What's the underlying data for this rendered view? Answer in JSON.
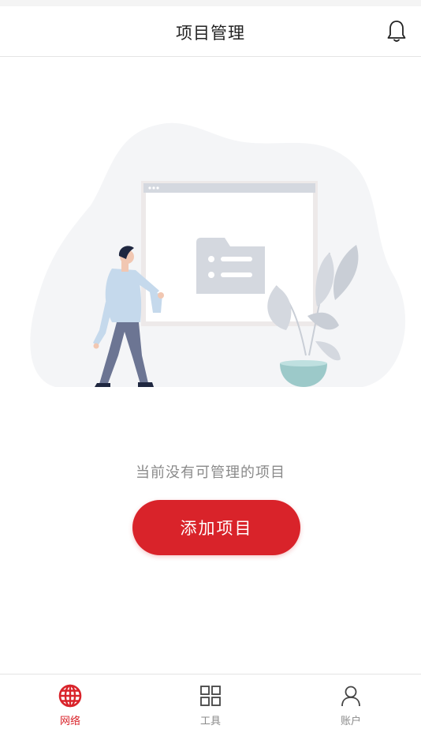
{
  "header": {
    "title": "项目管理",
    "bell_icon": "bell-icon"
  },
  "empty_state": {
    "illustration": "empty-projects-illustration",
    "message": "当前没有可管理的项目",
    "add_button_label": "添加项目"
  },
  "tabbar": {
    "tabs": [
      {
        "label": "网络",
        "icon": "globe-icon",
        "active": true
      },
      {
        "label": "工具",
        "icon": "grid-icon",
        "active": false
      },
      {
        "label": "账户",
        "icon": "user-icon",
        "active": false
      }
    ]
  },
  "colors": {
    "accent": "#d9232a",
    "muted_text": "#8a8a8a",
    "title_text": "#222222"
  }
}
